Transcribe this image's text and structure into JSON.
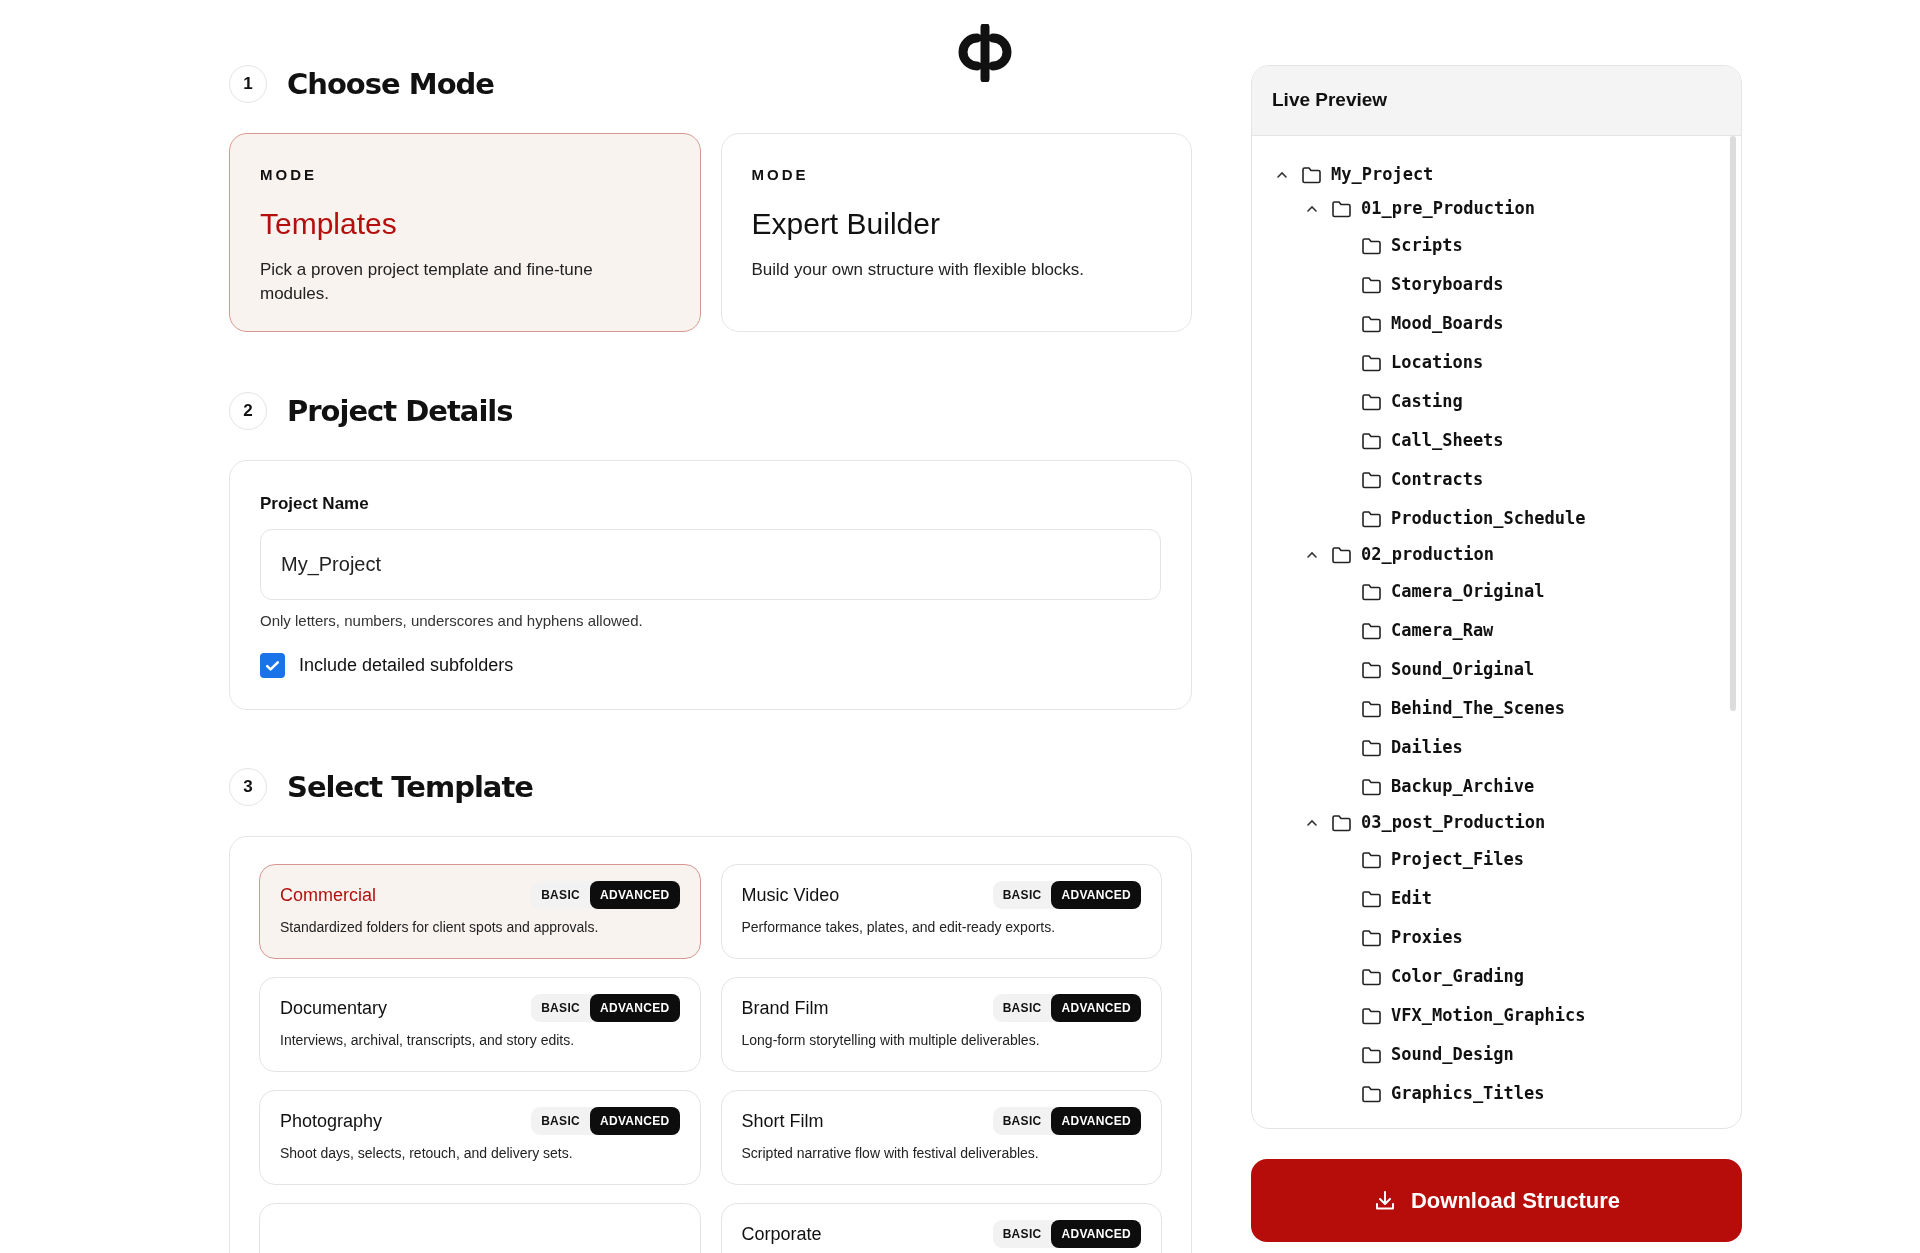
{
  "mode_section": {
    "number": "1",
    "title": "Choose Mode",
    "modes": [
      {
        "eyebrow": "MODE",
        "title": "Templates",
        "description": "Pick a proven project template and fine-tune modules.",
        "selected": true
      },
      {
        "eyebrow": "MODE",
        "title": "Expert Builder",
        "description": "Build your own structure with flexible blocks.",
        "selected": false
      }
    ]
  },
  "details_section": {
    "number": "2",
    "title": "Project Details",
    "field_label": "Project Name",
    "value": "My_Project",
    "help": "Only letters, numbers, underscores and hyphens allowed.",
    "checkbox": {
      "label": "Include detailed subfolders",
      "checked": true
    }
  },
  "template_section": {
    "number": "3",
    "title": "Select Template",
    "templates": [
      {
        "title": "Commercial",
        "description": "Standardized folders for client spots and approvals.",
        "selected": true,
        "levels": [
          {
            "label": "BASIC",
            "selected": false
          },
          {
            "label": "ADVANCED",
            "selected": true
          }
        ]
      },
      {
        "title": "Music Video",
        "description": "Performance takes, plates, and edit-ready exports.",
        "selected": false,
        "levels": [
          {
            "label": "BASIC",
            "selected": false
          },
          {
            "label": "ADVANCED",
            "selected": true
          }
        ]
      },
      {
        "title": "Documentary",
        "description": "Interviews, archival, transcripts, and story edits.",
        "selected": false,
        "levels": [
          {
            "label": "BASIC",
            "selected": false
          },
          {
            "label": "ADVANCED",
            "selected": true
          }
        ]
      },
      {
        "title": "Brand Film",
        "description": "Long-form storytelling with multiple deliverables.",
        "selected": false,
        "levels": [
          {
            "label": "BASIC",
            "selected": false
          },
          {
            "label": "ADVANCED",
            "selected": true
          }
        ]
      },
      {
        "title": "Photography",
        "description": "Shoot days, selects, retouch, and delivery sets.",
        "selected": false,
        "levels": [
          {
            "label": "BASIC",
            "selected": false
          },
          {
            "label": "ADVANCED",
            "selected": true
          }
        ]
      },
      {
        "title": "Short Film",
        "description": "Scripted narrative flow with festival deliverables.",
        "selected": false,
        "levels": [
          {
            "label": "BASIC",
            "selected": false
          },
          {
            "label": "ADVANCED",
            "selected": true
          }
        ]
      },
      {
        "selected": false
      },
      {
        "title": "Corporate",
        "selected": false,
        "levels": [
          {
            "label": "BASIC",
            "selected": false
          },
          {
            "label": "ADVANCED",
            "selected": true
          }
        ]
      }
    ]
  },
  "preview": {
    "title": "Live Preview",
    "tree": [
      {
        "name": "My_Project",
        "expanded": true,
        "children": [
          {
            "name": "01_pre_Production",
            "expanded": true,
            "children": [
              {
                "name": "Scripts"
              },
              {
                "name": "Storyboards"
              },
              {
                "name": "Mood_Boards"
              },
              {
                "name": "Locations"
              },
              {
                "name": "Casting"
              },
              {
                "name": "Call_Sheets"
              },
              {
                "name": "Contracts"
              },
              {
                "name": "Production_Schedule"
              }
            ]
          },
          {
            "name": "02_production",
            "expanded": true,
            "children": [
              {
                "name": "Camera_Original"
              },
              {
                "name": "Camera_Raw"
              },
              {
                "name": "Sound_Original"
              },
              {
                "name": "Behind_The_Scenes"
              },
              {
                "name": "Dailies"
              },
              {
                "name": "Backup_Archive"
              }
            ]
          },
          {
            "name": "03_post_Production",
            "expanded": true,
            "children": [
              {
                "name": "Project_Files"
              },
              {
                "name": "Edit"
              },
              {
                "name": "Proxies"
              },
              {
                "name": "Color_Grading"
              },
              {
                "name": "VFX_Motion_Graphics"
              },
              {
                "name": "Sound_Design"
              },
              {
                "name": "Graphics_Titles"
              }
            ]
          }
        ]
      }
    ]
  },
  "download_button": {
    "label": "Download Structure"
  }
}
